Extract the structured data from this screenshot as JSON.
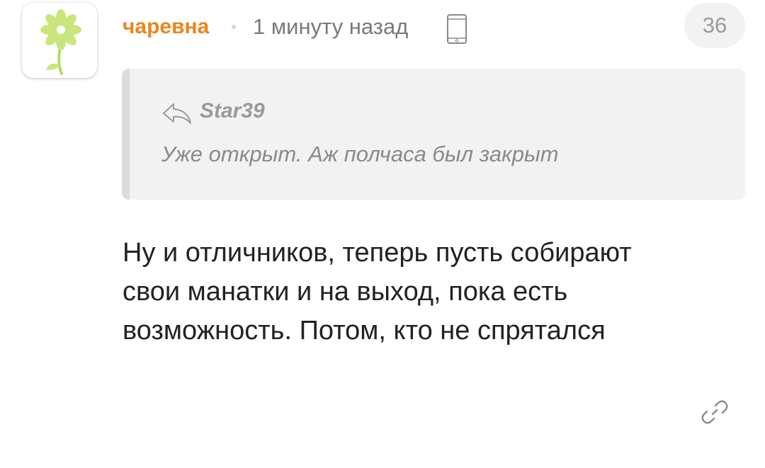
{
  "comment": {
    "author": "чаревна",
    "time": "1 минуту назад",
    "device_icon": "phone-icon",
    "score": "36",
    "quote": {
      "author": "Star39",
      "text": "Уже открыт. Аж полчаса был закрыт"
    },
    "body_lines": [
      "Ну и отличников, теперь пусть собирают",
      "свои манатки и на выход, пока есть",
      "возможность. Потом, кто не спрятался"
    ]
  },
  "colors": {
    "author": "#e8871e",
    "meta": "#7a7a7a",
    "quote_bg": "#f2f2f2",
    "quote_bar": "#dcdcdc",
    "body_text": "#222222",
    "avatar_flower": "#c8e67a"
  },
  "icons": {
    "avatar": "flower-avatar",
    "reply": "reply-arrow-icon",
    "link": "link-icon"
  }
}
